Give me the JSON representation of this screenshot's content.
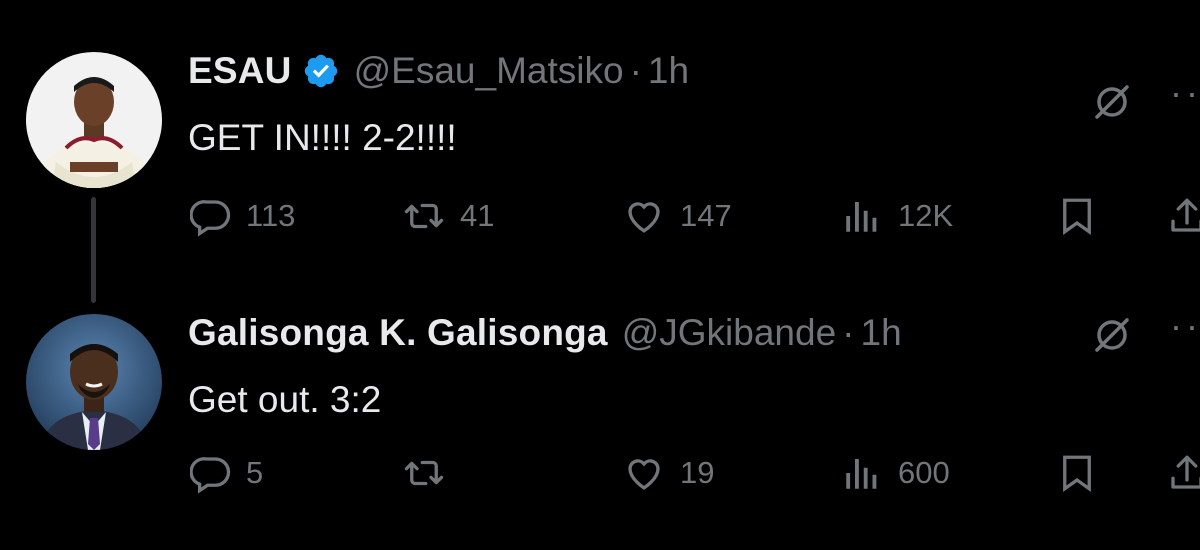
{
  "tweets": [
    {
      "name": "ESAU",
      "verified": true,
      "handle": "@Esau_Matsiko",
      "separator": "·",
      "time": "1h",
      "text": "GET IN!!!! 2-2!!!!",
      "replies": "113",
      "retweets": "41",
      "likes": "147",
      "views": "12K"
    },
    {
      "name": "Galisonga K. Galisonga",
      "verified": false,
      "handle": "@JGkibande",
      "separator": "·",
      "time": "1h",
      "text": "Get out. 3:2",
      "replies": "5",
      "retweets": "",
      "likes": "19",
      "views": "600"
    }
  ],
  "colors": {
    "background": "#000000",
    "text": "#e7e9ea",
    "muted": "#71767b",
    "verified": "#1d9bf0"
  },
  "icons": [
    "reply-icon",
    "retweet-icon",
    "like-icon",
    "views-icon",
    "bookmark-icon",
    "share-icon",
    "grok-icon",
    "more-icon",
    "verified-badge-icon"
  ]
}
